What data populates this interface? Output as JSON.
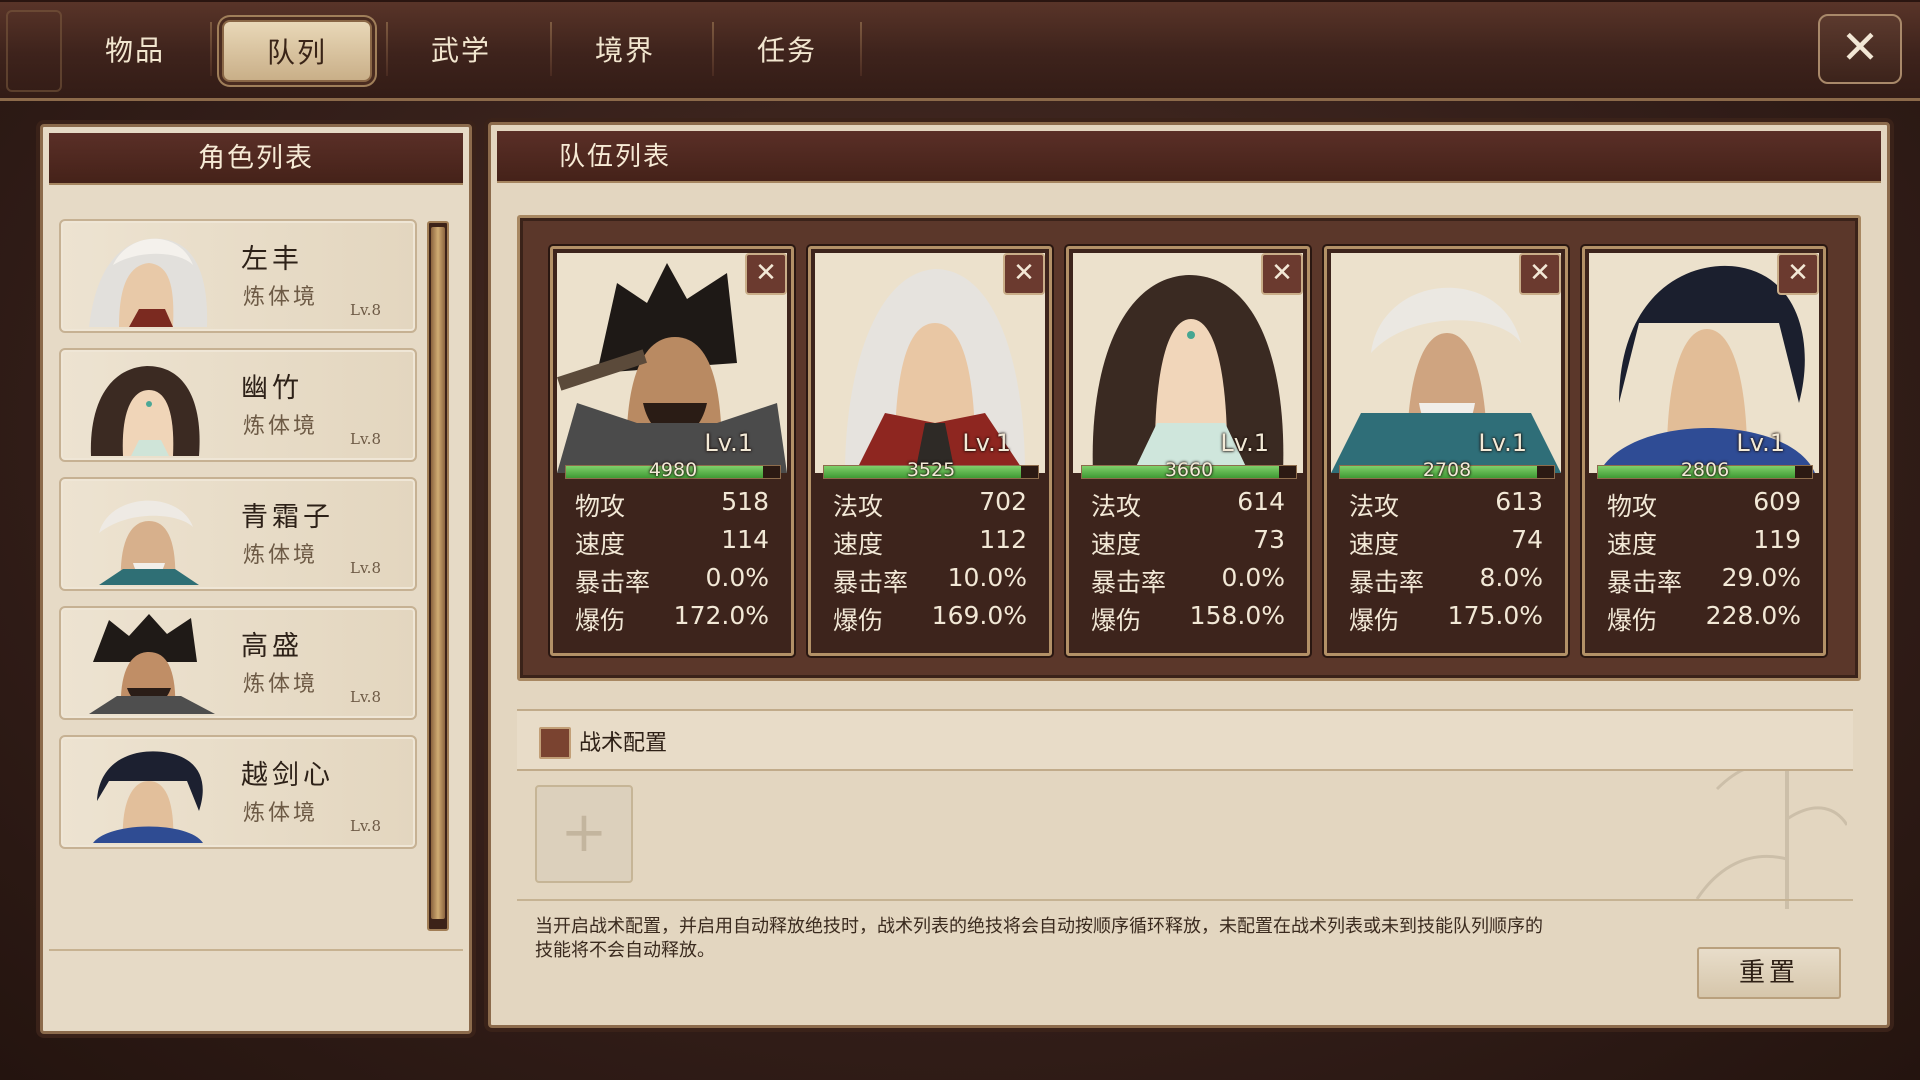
{
  "tabs": [
    {
      "label": "物品",
      "active": false
    },
    {
      "label": "队列",
      "active": true
    },
    {
      "label": "武学",
      "active": false
    },
    {
      "label": "境界",
      "active": false
    },
    {
      "label": "任务",
      "active": false
    }
  ],
  "close_label": "✕",
  "left_panel": {
    "title": "角色列表",
    "characters": [
      {
        "name": "左丰",
        "realm": "炼体境",
        "level": "Lv.8"
      },
      {
        "name": "幽竹",
        "realm": "炼体境",
        "level": "Lv.8"
      },
      {
        "name": "青霜子",
        "realm": "炼体境",
        "level": "Lv.8"
      },
      {
        "name": "高盛",
        "realm": "炼体境",
        "level": "Lv.8"
      },
      {
        "name": "越剑心",
        "realm": "炼体境",
        "level": "Lv.8"
      }
    ]
  },
  "right_panel": {
    "title": "队伍列表",
    "members": [
      {
        "level": "Lv.1",
        "hp": "4980",
        "stats": [
          [
            "物攻",
            "518"
          ],
          [
            "速度",
            "114"
          ],
          [
            "暴击率",
            "0.0%"
          ],
          [
            "爆伤",
            "172.0%"
          ]
        ]
      },
      {
        "level": "Lv.1",
        "hp": "3525",
        "stats": [
          [
            "法攻",
            "702"
          ],
          [
            "速度",
            "112"
          ],
          [
            "暴击率",
            "10.0%"
          ],
          [
            "爆伤",
            "169.0%"
          ]
        ]
      },
      {
        "level": "Lv.1",
        "hp": "3660",
        "stats": [
          [
            "法攻",
            "614"
          ],
          [
            "速度",
            "73"
          ],
          [
            "暴击率",
            "0.0%"
          ],
          [
            "爆伤",
            "158.0%"
          ]
        ]
      },
      {
        "level": "Lv.1",
        "hp": "2708",
        "stats": [
          [
            "法攻",
            "613"
          ],
          [
            "速度",
            "74"
          ],
          [
            "暴击率",
            "8.0%"
          ],
          [
            "爆伤",
            "175.0%"
          ]
        ]
      },
      {
        "level": "Lv.1",
        "hp": "2806",
        "stats": [
          [
            "物攻",
            "609"
          ],
          [
            "速度",
            "119"
          ],
          [
            "暴击率",
            "29.0%"
          ],
          [
            "爆伤",
            "228.0%"
          ]
        ]
      }
    ],
    "tactic": {
      "title": "战术配置",
      "add_slot": "+",
      "description": "当开启战术配置，并启用自动释放绝技时，战术列表的绝技将会自动按顺序循环释放，未配置在战术列表或未到技能队列顺序的技能将不会自动释放。",
      "reset_label": "重置"
    }
  },
  "colors": {
    "frame_dark": "#3e231c",
    "panel_header": "#5a2f27",
    "parchment": "#e6dac6",
    "hp_green": "#5cb548"
  }
}
